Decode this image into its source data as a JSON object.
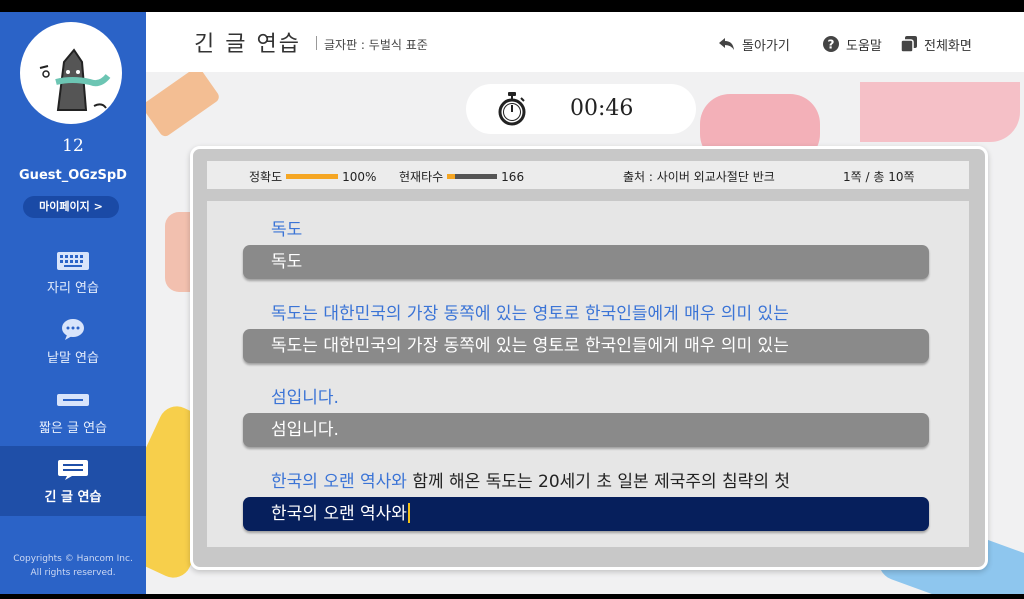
{
  "sidebar": {
    "level": "12",
    "username": "Guest_OGzSpD",
    "mypage_label": "마이페이지 >",
    "nav": [
      {
        "label": "자리 연습",
        "icon": "keyboard-icon"
      },
      {
        "label": "낱말 연습",
        "icon": "speech-bubble-icon"
      },
      {
        "label": "짧은 글 연습",
        "icon": "short-text-icon"
      },
      {
        "label": "긴 글 연습",
        "icon": "long-text-icon",
        "active": true
      }
    ],
    "copyright_line1": "Copyrights © Hancom Inc.",
    "copyright_line2": "All rights reserved."
  },
  "header": {
    "title": "긴 글 연습",
    "keyboard_layout": "글자판 : 두벌식 표준",
    "back_label": "돌아가기",
    "help_label": "도움말",
    "fullscreen_label": "전체화면"
  },
  "timer": {
    "time": "00:46"
  },
  "stats": {
    "accuracy_label": "정확도",
    "accuracy_value": "100%",
    "accuracy_fraction": 1.0,
    "speed_label": "현재타수",
    "speed_value": "166",
    "source": "출처 : 사이버 외교사절단 반크",
    "page": "1쪽 / 총 10쪽"
  },
  "lines": [
    {
      "typed_part": "독도",
      "rest": "",
      "input": "독도"
    },
    {
      "typed_part": "독도는 대한민국의 가장 동쪽에 있는 영토로 한국인들에게 매우 의미 있는",
      "rest": "",
      "input": "독도는 대한민국의 가장 동쪽에 있는 영토로 한국인들에게 매우 의미 있는"
    },
    {
      "typed_part": "섬입니다.",
      "rest": "",
      "input": "섬입니다."
    },
    {
      "typed_part": "한국의 오랜 역사와",
      "rest": " 함께 해온 독도는 20세기 초 일본 제국주의 침략의 첫",
      "input": "한국의 오랜 역사와"
    }
  ],
  "colors": {
    "sidebar": "#2b63c7",
    "typed_text": "#3b74d6",
    "active_input": "#061f5c",
    "inactive_input": "#8a8a8a",
    "accuracy_bar": "#f5a623",
    "caret": "#f3c21a"
  }
}
